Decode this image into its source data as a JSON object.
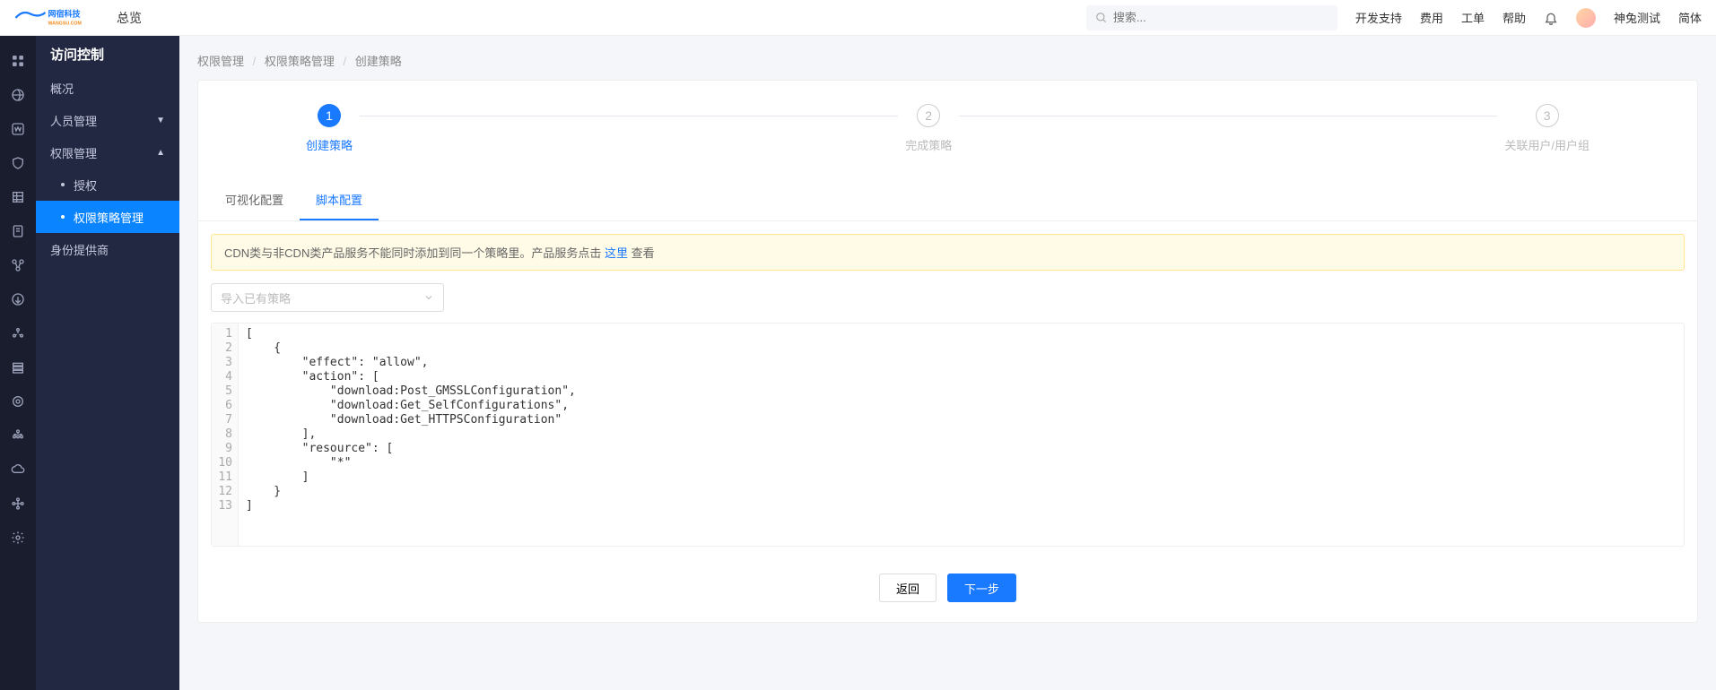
{
  "header": {
    "brand_main": "网宿科技",
    "brand_sub": "WANGSU.COM",
    "overview": "总览",
    "search_placeholder": "搜索...",
    "links": {
      "dev": "开发支持",
      "fee": "费用",
      "ticket": "工单",
      "help": "帮助"
    },
    "user": "神兔测试",
    "lang": "简体"
  },
  "sidebar": {
    "title": "访问控制",
    "overview": "概况",
    "personnel": "人员管理",
    "permission": "权限管理",
    "auth": "授权",
    "policy": "权限策略管理",
    "identity": "身份提供商"
  },
  "breadcrumb": {
    "a": "权限管理",
    "b": "权限策略管理",
    "c": "创建策略"
  },
  "steps": {
    "s1": "创建策略",
    "s2": "完成策略",
    "s3": "关联用户/用户组",
    "n1": "1",
    "n2": "2",
    "n3": "3"
  },
  "tabs": {
    "visual": "可视化配置",
    "script": "脚本配置"
  },
  "alert": {
    "pre": "CDN类与非CDN类产品服务不能同时添加到同一个策略里。产品服务点击 ",
    "link": "这里",
    "post": " 查看"
  },
  "select_placeholder": "导入已有策略",
  "code": {
    "lines": [
      "[",
      "    {",
      "        \"effect\": \"allow\",",
      "        \"action\": [",
      "            \"download:Post_GMSSLConfiguration\",",
      "            \"download:Get_SelfConfigurations\",",
      "            \"download:Get_HTTPSConfiguration\"",
      "        ],",
      "        \"resource\": [",
      "            \"*\"",
      "        ]",
      "    }",
      "]"
    ]
  },
  "buttons": {
    "back": "返回",
    "next": "下一步"
  }
}
